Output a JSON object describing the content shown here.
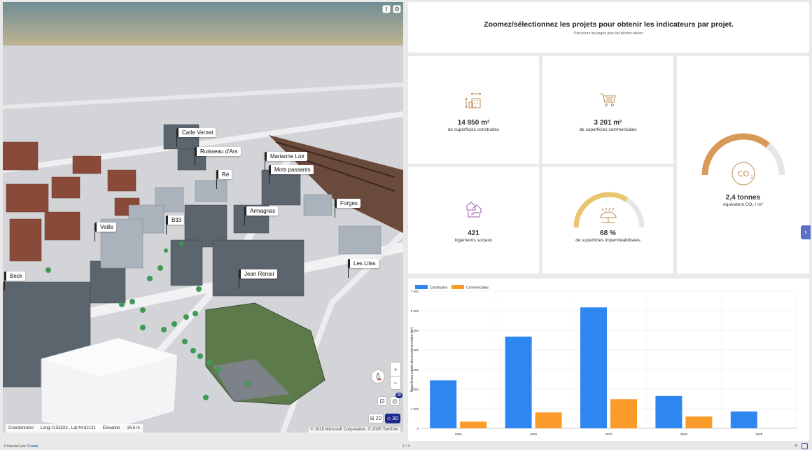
{
  "map": {
    "labels": [
      {
        "text": "Carle Vernet"
      },
      {
        "text": "Ruisseau d'Ars"
      },
      {
        "text": "Marianne Loir"
      },
      {
        "text": "Mots passants"
      },
      {
        "text": "Ré"
      },
      {
        "text": "Armagnac"
      },
      {
        "text": "Forges"
      },
      {
        "text": "B33"
      },
      {
        "text": "Veille"
      },
      {
        "text": "Jean Renoir"
      },
      {
        "text": "Les Lilas"
      },
      {
        "text": "Beck"
      }
    ],
    "coordinates_label": "Coordonnées",
    "coordinates_value": "Long:-0.55223 , Lat:44.82131",
    "elevation_label": "Élevation",
    "elevation_value": "26.6 m",
    "attribution": "© 2025 Microsoft Corporation, © 2025 TomTom",
    "zoom_in": "+",
    "zoom_out": "−",
    "mode_2d": "2D",
    "mode_3d": "3D",
    "badge_3d": "3D"
  },
  "header": {
    "title": "Zoomez/sélectionnez les projets pour obtenir les indicateurs par projet.",
    "subtitle": "Parcourez les pages avec les flèches bleues"
  },
  "kpis": {
    "built": {
      "value": "14 950 m²",
      "label": "de superficies construites",
      "icon": "building-resize-icon"
    },
    "commercial": {
      "value": "3 201 m²",
      "label": "de superficies commerciales",
      "icon": "shopping-cart-icon"
    },
    "co2": {
      "value": "2,4 tonnes",
      "label": "équivalent CO₂ / m²",
      "icon": "co2-icon",
      "gauge_fraction": 0.72,
      "color": "#d89a56"
    },
    "social": {
      "value": "421",
      "label": "logements sociaux",
      "icon": "houses-icon"
    },
    "impermeable": {
      "value": "68 %",
      "label": "de superficies imperméabilisées",
      "icon": "rain-umbrella-icon",
      "gauge_fraction": 0.68,
      "color": "#e9c56c"
    }
  },
  "chart_data": {
    "type": "bar",
    "categories": [
      "2025",
      "2026",
      "2027",
      "2028",
      "2029"
    ],
    "series": [
      {
        "name": "Construites",
        "values": [
          2450,
          4680,
          6170,
          1650,
          860
        ],
        "color": "#2e86f0"
      },
      {
        "name": "Commerciales",
        "values": [
          340,
          810,
          1490,
          600,
          0
        ],
        "color": "#fb9c2a"
      }
    ],
    "ylabel": "Superficies construites/commerciales (m²)",
    "ylim": [
      0,
      7000
    ],
    "yticks": [
      "0",
      "1 000",
      "2 000",
      "3 000",
      "4 000",
      "5 000",
      "6 000",
      "7 000"
    ],
    "legend": "top-left",
    "grid": true
  },
  "footer": {
    "powered_prefix": "Propulsé par",
    "powered_link": "Sirade",
    "page_indicator": "1 / 4"
  },
  "colors": {
    "accent": "#5b6ec8",
    "icon_purple": "#9b59b6",
    "icon_tan": "#b88a50"
  }
}
